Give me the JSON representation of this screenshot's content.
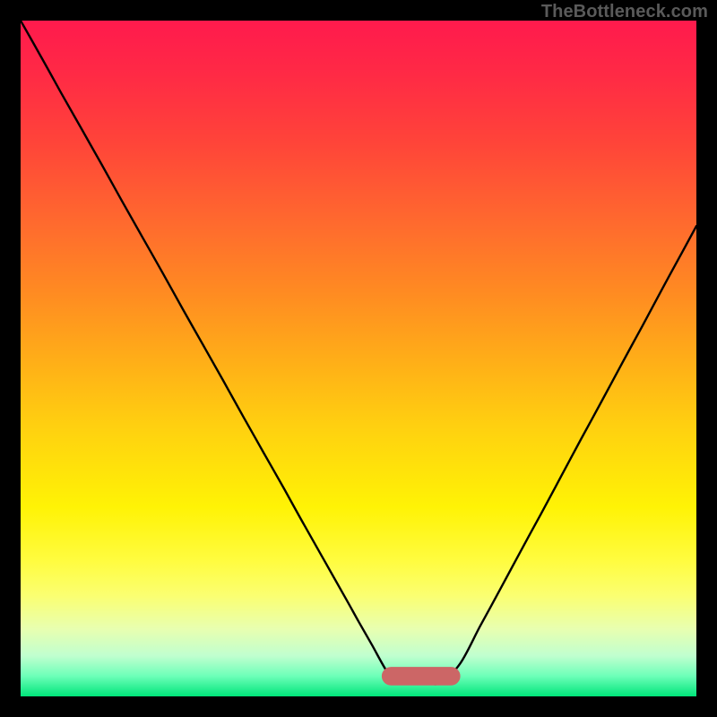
{
  "watermark": "TheBottleneck.com",
  "colors": {
    "curve": "#000000",
    "hump": "#cc6666",
    "hump_fill": "#cc6666"
  },
  "chart_data": {
    "type": "line",
    "title": "",
    "xlabel": "",
    "ylabel": "",
    "xlim": [
      0,
      100
    ],
    "ylim": [
      0,
      100
    ],
    "series": [
      {
        "name": "bottleneck-curve",
        "x": [
          0,
          3,
          6,
          9,
          12,
          15,
          18,
          21,
          24,
          27,
          30,
          33,
          36,
          39,
          42,
          45,
          48,
          50,
          52,
          54,
          55.5,
          57,
          60,
          62,
          65,
          68,
          71,
          74,
          77,
          80,
          83,
          86,
          89,
          92,
          95,
          98,
          100
        ],
        "y": [
          100,
          94.7,
          89.3,
          84.0,
          78.7,
          73.3,
          68.0,
          62.7,
          57.3,
          52.0,
          46.7,
          41.3,
          36.0,
          30.7,
          25.3,
          20.0,
          14.7,
          11.1,
          7.6,
          4.0,
          2.0,
          2.0,
          2.0,
          2.0,
          4.8,
          10.4,
          15.9,
          21.5,
          27.0,
          32.6,
          38.2,
          43.7,
          49.3,
          54.8,
          60.4,
          65.9,
          69.6
        ]
      }
    ],
    "annotations": [
      {
        "name": "valley-hump",
        "x_range": [
          53.5,
          65
        ],
        "y": 3.0,
        "shape": "rounded-bar"
      }
    ]
  }
}
